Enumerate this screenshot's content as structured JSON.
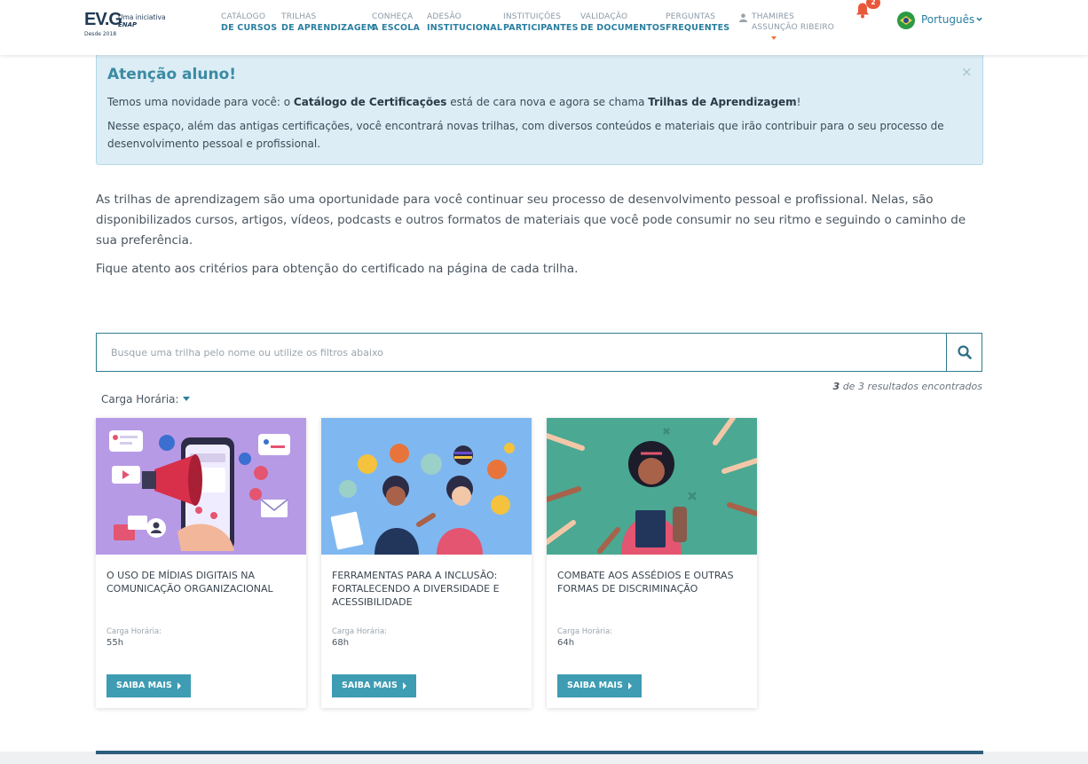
{
  "header": {
    "logo": {
      "main": "EV.G",
      "since": "Desde 2018",
      "tag1": "Uma iniciativa",
      "tag2": "ENAP"
    },
    "nav": [
      {
        "top": "CATÁLOGO",
        "bottom": "DE CURSOS"
      },
      {
        "top": "TRILHAS",
        "bottom": "DE APRENDIZAGEM"
      },
      {
        "top": "CONHEÇA",
        "bottom": "A ESCOLA"
      },
      {
        "top": "ADESÃO",
        "bottom": "INSTITUCIONAL"
      },
      {
        "top": "INSTITUIÇÕES",
        "bottom": "PARTICIPANTES"
      },
      {
        "top": "VALIDAÇÃO",
        "bottom": "DE DOCUMENTOS"
      },
      {
        "top": "PERGUNTAS",
        "bottom": "FREQUENTES"
      }
    ],
    "user": {
      "first": "THAMIRES",
      "last": "ASSUNÇÃO RIBEIRO"
    },
    "notifications_count": "2",
    "language": "Português"
  },
  "alert": {
    "title": "Atenção aluno!",
    "close": "×",
    "p1_a": "Temos uma novidade para você: o ",
    "p1_b": "Catálogo de Certificações",
    "p1_c": " está de cara nova e agora se chama ",
    "p1_d": "Trilhas de Aprendizagem",
    "p1_e": "!",
    "p2": "Nesse espaço, além das antigas certificações, você encontrará novas trilhas, com diversos conteúdos e materiais que irão contribuir para o seu processo de desenvolvimento pessoal e profissional."
  },
  "intro": {
    "p1": "As trilhas de aprendizagem são uma oportunidade para você continuar seu processo de desenvolvimento pessoal e profissional. Nelas, são disponibilizados cursos, artigos, vídeos, podcasts e outros formatos de materiais que você pode consumir no seu ritmo e seguindo o caminho de sua preferência.",
    "p2": "Fique atento aos critérios para obtenção do certificado na página de cada trilha."
  },
  "search": {
    "placeholder": "Busque uma trilha pelo nome ou utilize os filtros abaixo",
    "results_count": "3",
    "results_text": " de 3 resultados encontrados"
  },
  "filter": {
    "label": "Carga Horária:"
  },
  "cards": [
    {
      "title": "O USO DE MÍDIAS DIGITAIS NA COMUNICAÇÃO ORGANIZACIONAL",
      "hours_label": "Carga Horária:",
      "hours": "55h",
      "button": "SAIBA MAIS"
    },
    {
      "title": "FERRAMENTAS PARA A INCLUSÃO: FORTALECENDO A DIVERSIDADE E ACESSIBILIDADE",
      "hours_label": "Carga Horária:",
      "hours": "68h",
      "button": "SAIBA MAIS"
    },
    {
      "title": "COMBATE AOS ASSÉDIOS E OUTRAS FORMAS DE DISCRIMINAÇÃO",
      "hours_label": "Carga Horária:",
      "hours": "64h",
      "button": "SAIBA MAIS"
    }
  ],
  "colors": {
    "accent": "#2a7fa0",
    "button": "#3e9cb3",
    "alert_bg": "#dcedf5",
    "badge": "#e8583b"
  }
}
